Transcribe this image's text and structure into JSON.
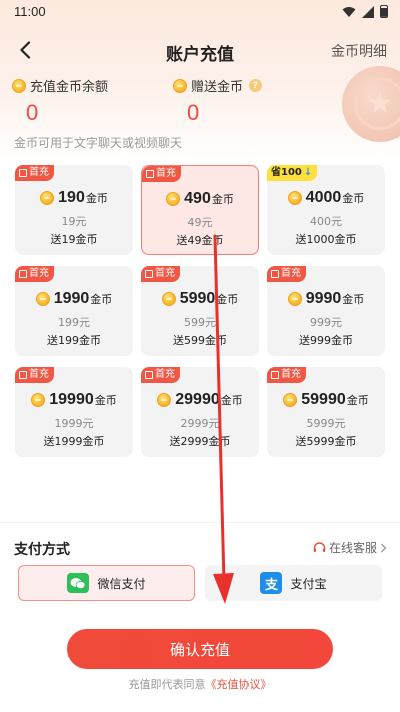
{
  "status_bar": {
    "time": "11:00"
  },
  "nav": {
    "title": "账户充值",
    "detail_link": "金币明细"
  },
  "balances": {
    "recharge": {
      "label": "充值金币余额",
      "value": "0"
    },
    "gift": {
      "label": "赠送金币",
      "value": "0"
    }
  },
  "usage_tip": "金币可用于文字聊天或视频聊天",
  "packages": [
    {
      "tag": "首充",
      "amount": "190",
      "unit": "金币",
      "price": "19元",
      "bonus": "送19金币"
    },
    {
      "tag": "首充",
      "amount": "490",
      "unit": "金币",
      "price": "49元",
      "bonus": "送49金币",
      "selected": true
    },
    {
      "tag": "省100",
      "amount": "4000",
      "unit": "金币",
      "price": "400元",
      "bonus": "送1000金币"
    },
    {
      "tag": "首充",
      "amount": "1990",
      "unit": "金币",
      "price": "199元",
      "bonus": "送199金币"
    },
    {
      "tag": "首充",
      "amount": "5990",
      "unit": "金币",
      "price": "599元",
      "bonus": "送599金币"
    },
    {
      "tag": "首充",
      "amount": "9990",
      "unit": "金币",
      "price": "999元",
      "bonus": "送999金币"
    },
    {
      "tag": "首充",
      "amount": "19990",
      "unit": "金币",
      "price": "1999元",
      "bonus": "送1999金币"
    },
    {
      "tag": "首充",
      "amount": "29990",
      "unit": "金币",
      "price": "2999元",
      "bonus": "送2999金币"
    },
    {
      "tag": "首充",
      "amount": "59990",
      "unit": "金币",
      "price": "5999元",
      "bonus": "送5999金币"
    }
  ],
  "payment": {
    "title": "支付方式",
    "service_link": "在线客服",
    "wechat_label": "微信支付",
    "alipay_label": "支付宝",
    "alipay_glyph": "支"
  },
  "confirm_label": "确认充值",
  "agreement": {
    "prefix": "充值即代表同意",
    "link": "《充值协议》"
  },
  "colors": {
    "accent": "#f04a3a",
    "coin": "#f9b92e",
    "overlay_arrow": "#e8312a"
  }
}
